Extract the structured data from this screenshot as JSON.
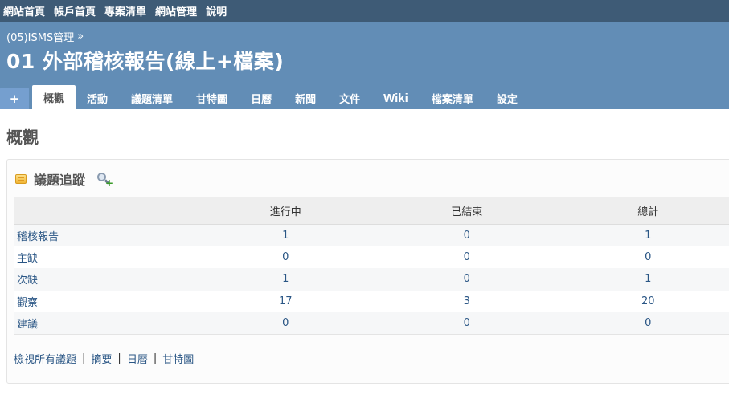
{
  "top_menu": {
    "items": [
      "網站首頁",
      "帳戶首頁",
      "專案清單",
      "網站管理",
      "說明"
    ]
  },
  "header": {
    "breadcrumb": "(05)ISMS管理",
    "breadcrumb_sep": "»",
    "project_title": "01 外部稽核報告(線上+檔案)"
  },
  "tabs": {
    "new": "+",
    "items": [
      "概觀",
      "活動",
      "議題清單",
      "甘特圖",
      "日曆",
      "新聞",
      "文件",
      "Wiki",
      "檔案清單",
      "設定"
    ],
    "selected": "概觀"
  },
  "main": {
    "title": "概觀"
  },
  "issue_tracking": {
    "title": "議題追蹤",
    "columns": [
      "",
      "進行中",
      "已結束",
      "總計"
    ],
    "rows": [
      {
        "tracker": "稽核報告",
        "open": "1",
        "closed": "0",
        "total": "1"
      },
      {
        "tracker": "主缺",
        "open": "0",
        "closed": "0",
        "total": "0"
      },
      {
        "tracker": "次缺",
        "open": "1",
        "closed": "0",
        "total": "1"
      },
      {
        "tracker": "觀察",
        "open": "17",
        "closed": "3",
        "total": "20"
      },
      {
        "tracker": "建議",
        "open": "0",
        "closed": "0",
        "total": "0"
      }
    ],
    "links": [
      "檢視所有議題",
      "摘要",
      "日曆",
      "甘特圖"
    ],
    "link_sep": "|"
  },
  "colors": {
    "top_menu_bg": "#3e5b76",
    "header_bg": "#628db6",
    "link": "#2a5685"
  }
}
